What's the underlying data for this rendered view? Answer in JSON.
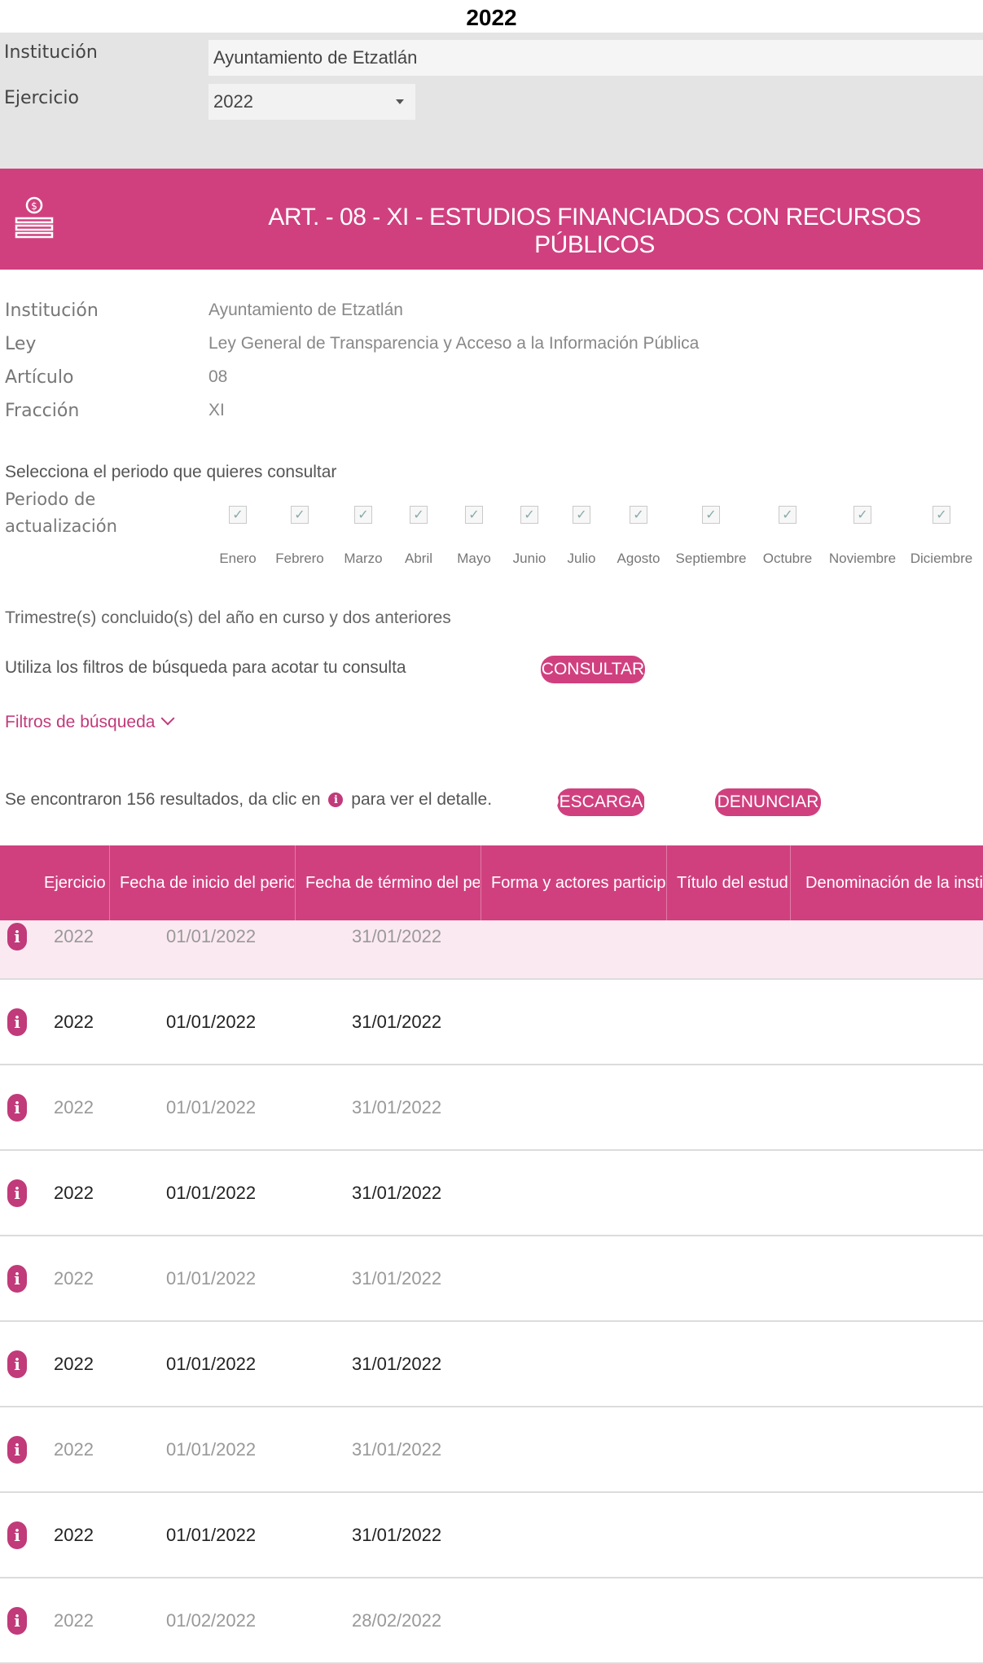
{
  "page_title": "2022",
  "filters_top": {
    "institucion_label": "Institución",
    "institucion_value": "Ayuntamiento de Etzatlán",
    "ejercicio_label": "Ejercicio",
    "ejercicio_value": "2022"
  },
  "banner": {
    "title": "ART. - 08 - XI - ESTUDIOS FINANCIADOS CON RECURSOS PÚBLICOS",
    "icon": "money-stack-icon",
    "color": "#d0407f"
  },
  "info": [
    {
      "label": "Institución",
      "value": "Ayuntamiento de Etzatlán"
    },
    {
      "label": "Ley",
      "value": "Ley General de Transparencia y Acceso a la Información Pública"
    },
    {
      "label": "Artículo",
      "value": "08"
    },
    {
      "label": "Fracción",
      "value": "XI"
    }
  ],
  "period": {
    "prompt": "Selecciona el periodo que quieres consultar",
    "label_line1": "Periodo de",
    "label_line2": "actualización",
    "months": [
      "Enero",
      "Febrero",
      "Marzo",
      "Abril",
      "Mayo",
      "Junio",
      "Julio",
      "Agosto",
      "Septiembre",
      "Octubre",
      "Noviembre",
      "Diciembre"
    ],
    "all_checked": true
  },
  "trimestre_text": "Trimestre(s) concluido(s) del año en curso y dos anteriores",
  "filter_hint": "Utiliza los filtros de búsqueda para acotar tu consulta",
  "consultar_label": "CONSULTAR",
  "filtros_label": "Filtros de búsqueda",
  "results": {
    "prefix": "Se encontraron 156 resultados, da clic en",
    "suffix": "para ver el detalle."
  },
  "descargar_label": "DESCARGAR",
  "denunciar_label": "DENUNCIAR",
  "table": {
    "headers": [
      "Ejercicio",
      "Fecha de inicio del perio...",
      "Fecha de término del per...",
      "Forma y actores particip...",
      "Título del estudio",
      "Denominación de la insti..."
    ],
    "rows": [
      {
        "ejercicio": "2022",
        "inicio": "01/01/2022",
        "termino": "31/01/2022"
      },
      {
        "ejercicio": "2022",
        "inicio": "01/01/2022",
        "termino": "31/01/2022"
      },
      {
        "ejercicio": "2022",
        "inicio": "01/01/2022",
        "termino": "31/01/2022"
      },
      {
        "ejercicio": "2022",
        "inicio": "01/01/2022",
        "termino": "31/01/2022"
      },
      {
        "ejercicio": "2022",
        "inicio": "01/01/2022",
        "termino": "31/01/2022"
      },
      {
        "ejercicio": "2022",
        "inicio": "01/01/2022",
        "termino": "31/01/2022"
      },
      {
        "ejercicio": "2022",
        "inicio": "01/01/2022",
        "termino": "31/01/2022"
      },
      {
        "ejercicio": "2022",
        "inicio": "01/01/2022",
        "termino": "31/01/2022"
      },
      {
        "ejercicio": "2022",
        "inicio": "01/02/2022",
        "termino": "28/02/2022"
      }
    ]
  },
  "colors": {
    "accent": "#d0407f",
    "panel": "#e4e4e4"
  }
}
